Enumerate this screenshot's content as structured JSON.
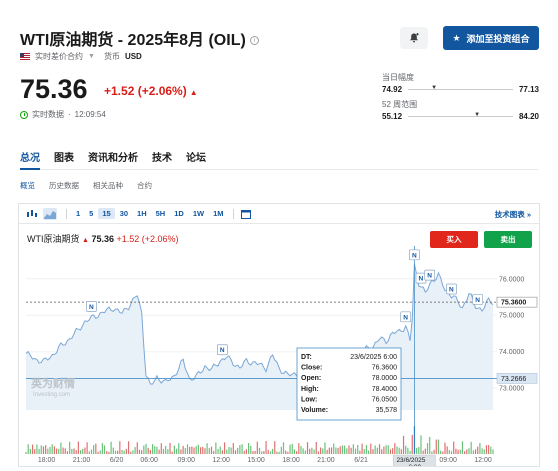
{
  "header": {
    "title": "WTI原油期货 - 2025年8月 (OIL)",
    "info_icon": "info-icon",
    "quote_type": "实时差价合约",
    "currency_label": "货币",
    "currency": "USD"
  },
  "quote": {
    "price": "75.36",
    "change": "+1.52 (+2.06%)",
    "realtime_label": "实时数据",
    "time": "12:09:54"
  },
  "actions": {
    "alert_icon": "bell-plus-icon",
    "add_portfolio": "添加至投资组合"
  },
  "ranges": {
    "day_label": "当日幅度",
    "day_low": "74.92",
    "day_high": "77.13",
    "week52_label": "52 周范围",
    "week52_low": "55.12",
    "week52_high": "84.20"
  },
  "tabs": [
    "总况",
    "图表",
    "资讯和分析",
    "技术",
    "论坛"
  ],
  "subtabs": [
    "概览",
    "历史数据",
    "相关品种",
    "合约"
  ],
  "toolbar": {
    "timeframes": [
      "1",
      "5",
      "15",
      "30",
      "1H",
      "5H",
      "1D",
      "1W",
      "1M"
    ],
    "selected": "15",
    "tech_chart": "技术图表 »"
  },
  "chart_legend": {
    "name": "WTI原油期货",
    "price": "75.36",
    "change": "+1.52 (+2.06%)",
    "buy": "买入",
    "sell": "卖出"
  },
  "tooltip": {
    "dt_label": "DT:",
    "dt": "23/6/2025 6:00",
    "close_label": "Close:",
    "close": "76.3600",
    "open_label": "Open:",
    "open": "78.0000",
    "high_label": "High:",
    "high": "78.4000",
    "low_label": "Low:",
    "low": "76.0500",
    "volume_label": "Volume:",
    "volume": "35,578"
  },
  "watermark": {
    "text": "英为财情",
    "sub": "Investing.com"
  },
  "chart_data": {
    "type": "area",
    "y_ticks": [
      "76.0000",
      "75.0000",
      "74.0000",
      "73.0000"
    ],
    "ylim": [
      72.4,
      76.9
    ],
    "current_price_label": "75.3600",
    "crosshair_label": "73.2666",
    "x_ticks": [
      "18:00",
      "21:00",
      "6/20",
      "06:00",
      "09:00",
      "12:00",
      "15:00",
      "18:00",
      "21:00",
      "6/21",
      "23/6/2025 6:00",
      "09:00",
      "12:00"
    ],
    "x_tick_index": [
      10,
      26,
      43,
      57,
      74,
      90,
      106,
      122,
      138,
      155,
      178,
      194,
      210
    ],
    "x_count": 215,
    "crosshair_index": 178,
    "highlight_index": 178,
    "news_marker_indices": [
      30,
      90,
      174,
      178,
      181,
      185,
      195,
      207
    ]
  },
  "colors": {
    "accent": "#1256a0",
    "up": "#12a34a",
    "down": "#d91e18",
    "area_line": "#7aa7d6",
    "area_fill": "#e8f0f8"
  }
}
